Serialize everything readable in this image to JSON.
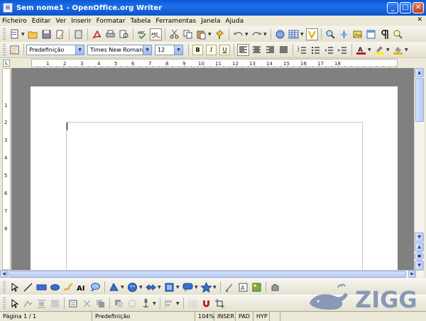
{
  "window": {
    "title": "Sem nome1 - OpenOffice.org Writer",
    "controls": {
      "minimize": "_",
      "maximize": "□",
      "close": "✕"
    }
  },
  "menu": {
    "items": [
      "Ficheiro",
      "Editar",
      "Ver",
      "Inserir",
      "Formatar",
      "Tabela",
      "Ferramentas",
      "Janela",
      "Ajuda"
    ],
    "close_glyph": "✕"
  },
  "formatting": {
    "style": "Predefinição",
    "font": "Times New Roman",
    "size": "12",
    "bold": "B",
    "italic": "I",
    "underline": "U"
  },
  "ruler": {
    "corner": "L",
    "labels": [
      "1",
      "2",
      "3",
      "4",
      "5",
      "6",
      "7",
      "8",
      "9",
      "10",
      "11",
      "12",
      "13",
      "14",
      "15",
      "16",
      "17",
      "18"
    ],
    "vertical_labels": [
      "1",
      "2",
      "3",
      "4",
      "5",
      "6",
      "7",
      "8"
    ]
  },
  "status": {
    "page": "Página 1 / 1",
    "style": "Predefinição",
    "zoom": "104%",
    "insert": "INSER",
    "selection": "PAD",
    "hyperlink": "HYP"
  },
  "watermark": {
    "text": "ZIGG",
    "color": "#8a98b8"
  },
  "colors": {
    "titlebar": "#0a5bd8",
    "toolbar_bg": "#ece9d8",
    "workspace": "#808080"
  },
  "toolbar_standard": [
    "new-document-icon",
    "open-folder-icon",
    "save-icon",
    "edit-file-icon",
    "export-pdf-icon",
    "print-icon",
    "page-preview-icon",
    "spellcheck-icon",
    "autospellcheck-icon",
    "cut-icon",
    "copy-icon",
    "paste-icon",
    "clone-format-icon",
    "undo-icon",
    "redo-icon",
    "hyperlink-icon",
    "table-icon",
    "show-draw-functions-icon",
    "navigator-icon",
    "gallery-icon",
    "data-sources-icon",
    "nonprinting-characters-icon",
    "zoom-icon"
  ],
  "toolbar_drawing": [
    "select-icon",
    "line-icon",
    "rectangle-icon",
    "ellipse-icon",
    "freeform-icon",
    "text-icon",
    "callout-icon",
    "basic-shapes-icon",
    "symbol-shapes-icon",
    "block-arrows-icon",
    "flowchart-icon",
    "callouts-icon",
    "stars-icon",
    "points-icon",
    "fontwork-icon",
    "from-file-icon",
    "extrusion-icon"
  ]
}
